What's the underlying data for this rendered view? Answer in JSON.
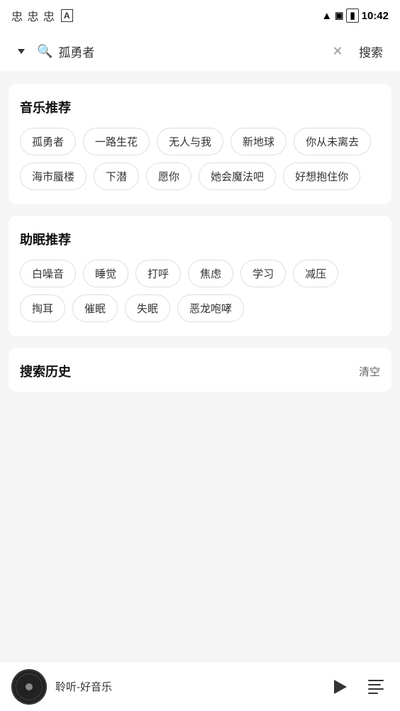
{
  "statusBar": {
    "time": "10:42",
    "icons": "忠忠忠"
  },
  "searchBar": {
    "query": "孤勇者",
    "searchLabel": "搜索",
    "placeholder": "搜索"
  },
  "musicSection": {
    "title": "音乐推荐",
    "tags": [
      "孤勇者",
      "一路生花",
      "无人与我",
      "新地球",
      "你从未离去",
      "海市蜃楼",
      "下潜",
      "愿你",
      "她会魔法吧",
      "好想抱住你"
    ]
  },
  "sleepSection": {
    "title": "助眠推荐",
    "tags": [
      "白噪音",
      "睡觉",
      "打呼",
      "焦虑",
      "学习",
      "减压",
      "掏耳",
      "催眠",
      "失眠",
      "恶龙咆哮"
    ]
  },
  "historySection": {
    "title": "搜索历史",
    "clearLabel": "清空"
  },
  "player": {
    "title": "聆听-好音乐"
  }
}
